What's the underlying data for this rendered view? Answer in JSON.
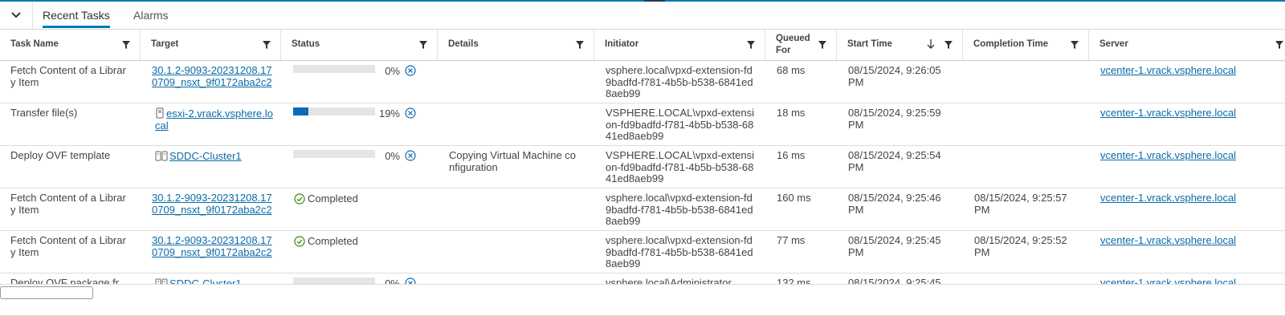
{
  "tabs": [
    {
      "label": "Recent Tasks",
      "active": true
    },
    {
      "label": "Alarms",
      "active": false
    }
  ],
  "columns": [
    {
      "label": "Task Name"
    },
    {
      "label": "Target"
    },
    {
      "label": "Status"
    },
    {
      "label": "Details"
    },
    {
      "label": "Initiator"
    },
    {
      "label": "Queued For"
    },
    {
      "label": "Start Time",
      "sorted": "descending"
    },
    {
      "label": "Completion Time"
    },
    {
      "label": "Server"
    }
  ],
  "rows": [
    {
      "task": "Fetch Content of a Library Item",
      "target": "30.1.2-9093-20231208.170709_nsxt_9f0172aba2c2",
      "target_icon": "",
      "status_type": "progress",
      "progress": 0,
      "progress_label": "0%",
      "details": "",
      "initiator": "vsphere.local\\vpxd-extension-fd9badfd-f781-4b5b-b538-6841ed8aeb99",
      "queued": "68 ms",
      "start": "08/15/2024, 9:26:05 PM",
      "completion": "",
      "server": "vcenter-1.vrack.vsphere.local"
    },
    {
      "task": "Transfer file(s)",
      "target": "esxi-2.vrack.vsphere.local",
      "target_icon": "host-icon",
      "status_type": "progress",
      "progress": 19,
      "progress_label": "19%",
      "details": "",
      "initiator": "VSPHERE.LOCAL\\vpxd-extension-fd9badfd-f781-4b5b-b538-6841ed8aeb99",
      "queued": "18 ms",
      "start": "08/15/2024, 9:25:59 PM",
      "completion": "",
      "server": "vcenter-1.vrack.vsphere.local"
    },
    {
      "task": "Deploy OVF template",
      "target": "SDDC-Cluster1",
      "target_icon": "cluster-icon",
      "status_type": "progress",
      "progress": 0,
      "progress_label": "0%",
      "details": "Copying Virtual Machine configuration",
      "initiator": "VSPHERE.LOCAL\\vpxd-extension-fd9badfd-f781-4b5b-b538-6841ed8aeb99",
      "queued": "16 ms",
      "start": "08/15/2024, 9:25:54 PM",
      "completion": "",
      "server": "vcenter-1.vrack.vsphere.local"
    },
    {
      "task": "Fetch Content of a Library Item",
      "target": "30.1.2-9093-20231208.170709_nsxt_9f0172aba2c2",
      "target_icon": "",
      "status_type": "completed",
      "status_label": "Completed",
      "details": "",
      "initiator": "vsphere.local\\vpxd-extension-fd9badfd-f781-4b5b-b538-6841ed8aeb99",
      "queued": "160 ms",
      "start": "08/15/2024, 9:25:46 PM",
      "completion": "08/15/2024, 9:25:57 PM",
      "server": "vcenter-1.vrack.vsphere.local"
    },
    {
      "task": "Fetch Content of a Library Item",
      "target": "30.1.2-9093-20231208.170709_nsxt_9f0172aba2c2",
      "target_icon": "",
      "status_type": "completed",
      "status_label": "Completed",
      "details": "",
      "initiator": "vsphere.local\\vpxd-extension-fd9badfd-f781-4b5b-b538-6841ed8aeb99",
      "queued": "77 ms",
      "start": "08/15/2024, 9:25:45 PM",
      "completion": "08/15/2024, 9:25:52 PM",
      "server": "vcenter-1.vrack.vsphere.local"
    },
    {
      "task": "Deploy OVF package fr",
      "target": "SDDC-Cluster1",
      "target_icon": "cluster-icon",
      "status_type": "progress",
      "progress": 0,
      "progress_label": "0%",
      "details": "",
      "initiator": "vsphere.local\\Administrator",
      "queued": "132 ms",
      "start": "08/15/2024, 9:25:45",
      "completion": "",
      "server": "vcenter-1.vrack.vsphere.local"
    }
  ],
  "colors": {
    "accent": "#0079b8",
    "progress": "#0e6ab3",
    "success": "#3c8500",
    "link": "#0a6aa8"
  }
}
